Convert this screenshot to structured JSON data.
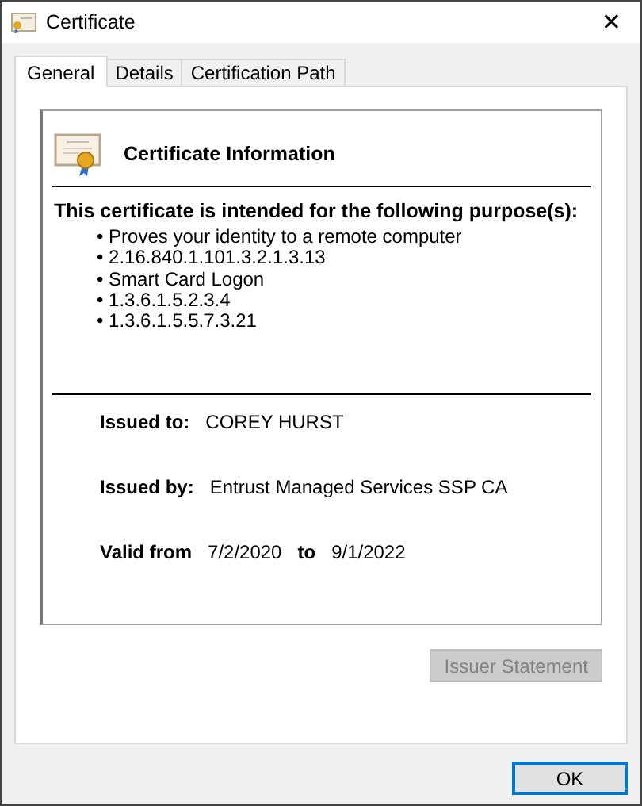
{
  "window": {
    "title": "Certificate",
    "close": "✕"
  },
  "tabs": [
    {
      "label": "General",
      "selected": true
    },
    {
      "label": "Details",
      "selected": false
    },
    {
      "label": "Certification Path",
      "selected": false
    }
  ],
  "info": {
    "heading": "Certificate Information",
    "purpose_title": "This certificate is intended for the following purpose(s):",
    "purposes": [
      "• Proves your identity to a remote computer",
      "• 2.16.840.1.101.3.2.1.3.13",
      "• Smart Card Logon",
      "• 1.3.6.1.5.2.3.4",
      "• 1.3.6.1.5.5.7.3.21"
    ],
    "issued_to_label": "Issued to:",
    "issued_to": "COREY HURST",
    "issued_by_label": "Issued by:",
    "issued_by": "Entrust Managed Services SSP CA",
    "valid_from_label": "Valid from",
    "valid_from": "7/2/2020",
    "valid_to_label": "to",
    "valid_to": "9/1/2022"
  },
  "issuer_button": {
    "label": "Issuer Statement",
    "disabled": true
  },
  "ok_button": {
    "label": "OK",
    "default": true
  }
}
